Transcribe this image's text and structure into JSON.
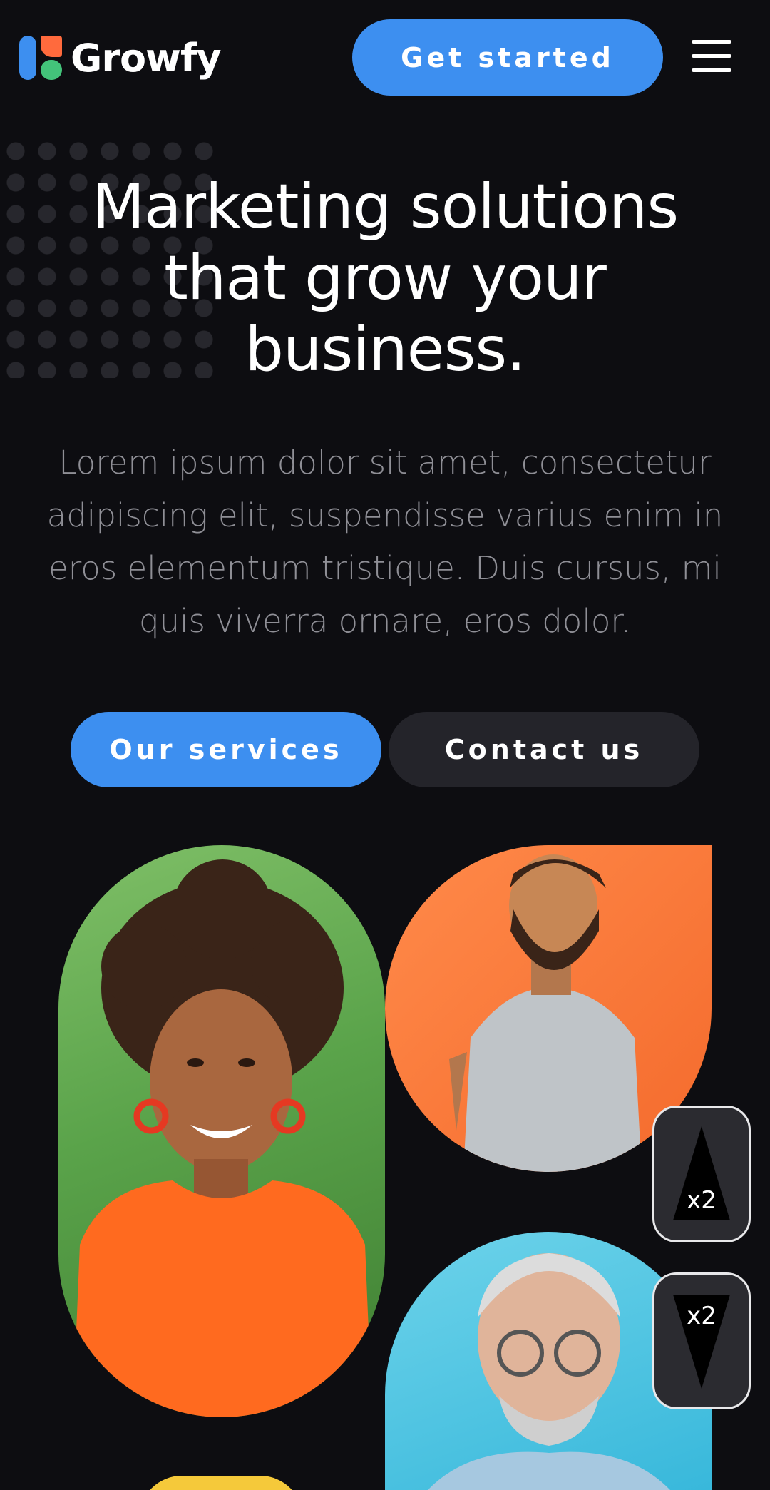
{
  "brand": {
    "name": "Growfy"
  },
  "header": {
    "cta_label": "Get started",
    "menu_icon": "hamburger-menu-icon"
  },
  "hero": {
    "title": "Marketing solutions that grow your business.",
    "subtitle": "Lorem ipsum dolor sit amet, consectetur adipiscing elit, suspendisse varius enim in eros elementum tristique. Duis cursus, mi quis viverra ornare, eros dolor."
  },
  "actions": {
    "primary_label": "Our services",
    "secondary_label": "Contact us"
  },
  "zoom": {
    "up_label": "x2",
    "down_label": "x2"
  },
  "colors": {
    "accent": "#3d8ff0",
    "background": "#0d0d11",
    "secondary_button": "#24242a",
    "logo_orange": "#ff6a3d",
    "logo_green": "#43c37a"
  }
}
